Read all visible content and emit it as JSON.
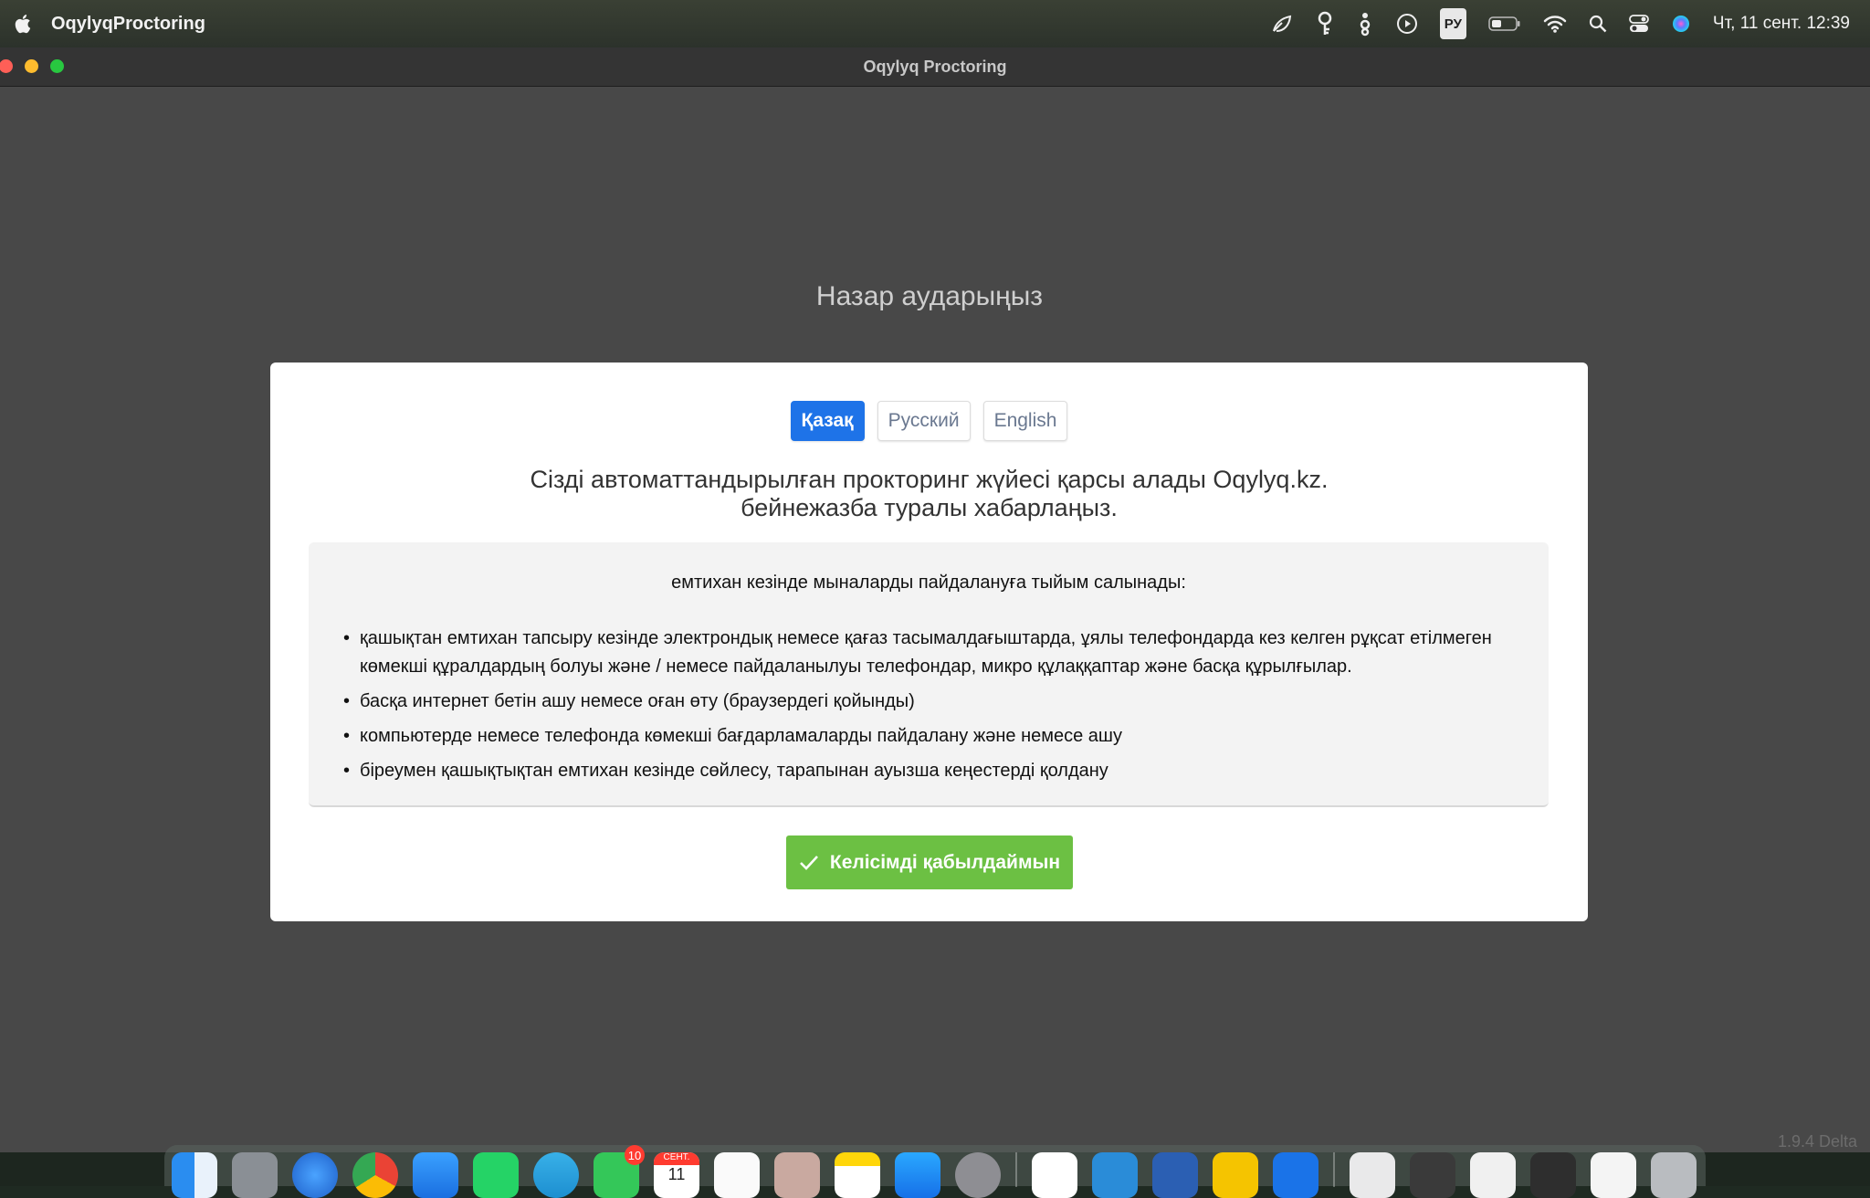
{
  "menubar": {
    "app_name": "OqylyqProctoring",
    "keyboard_layout": "РУ",
    "clock": "Чт, 11 сент.  12:39",
    "icons": [
      "apple-icon",
      "leaf-icon",
      "key-icon",
      "accessibility-icon",
      "play-icon",
      "keyboard-icon",
      "battery-icon",
      "wifi-icon",
      "search-icon",
      "control-center-icon",
      "siri-icon"
    ]
  },
  "window": {
    "title": "Oqylyq Proctoring",
    "heading": "Назар аударыңыз",
    "version": "1.9.4 Delta"
  },
  "card": {
    "languages": [
      {
        "label": "Қазақ",
        "active": true
      },
      {
        "label": "Русский",
        "active": false
      },
      {
        "label": "English",
        "active": false
      }
    ],
    "welcome_line1": "Сізді автоматтандырылған прокторинг жүйесі қарсы алады Oqylyq.kz.",
    "welcome_line2": "бейнежазба туралы хабарлаңыз.",
    "rules_title": "емтихан кезінде мыналарды пайдалануға тыйым салынады:",
    "rules": [
      "қашықтан емтихан тапсыру кезінде электрондық немесе қағаз тасымалдағыштарда, ұялы телефондарда кез келген рұқсат етілмеген көмекші құралдардың болуы және / немесе пайдаланылуы телефондар, микро құлаққаптар және басқа құрылғылар.",
      "басқа интернет бетін ашу немесе оған өту (браузердегі қойынды)",
      "компьютерде немесе телефонда көмекші бағдарламаларды пайдалану және немесе ашу",
      "біреумен қашықтықтан емтихан кезінде сөйлесу, тарапынан ауызша кеңестерді қолдану"
    ],
    "accept_label": "Келісімді қабылдаймын"
  },
  "dock": {
    "facetime_badge": "10",
    "calendar_month": "СЕНТ.",
    "calendar_day": "11",
    "colors": {
      "accent_blue": "#1e73e8",
      "accept_green": "#6cc043"
    }
  }
}
